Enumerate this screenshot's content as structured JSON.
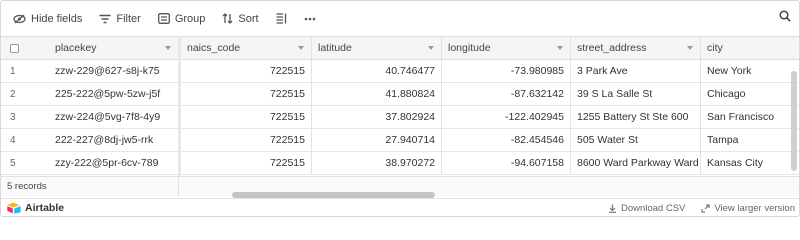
{
  "toolbar": {
    "hide_fields": "Hide fields",
    "filter": "Filter",
    "group": "Group",
    "sort": "Sort"
  },
  "table": {
    "columns": [
      "placekey",
      "naics_code",
      "latitude",
      "longitude",
      "street_address",
      "city"
    ],
    "rows": [
      {
        "num": "1",
        "placekey": "zzw-229@627-s8j-k75",
        "naics_code": "722515",
        "latitude": "40.746477",
        "longitude": "-73.980985",
        "street_address": "3 Park Ave",
        "city": "New York"
      },
      {
        "num": "2",
        "placekey": "225-222@5pw-5zw-j5f",
        "naics_code": "722515",
        "latitude": "41.880824",
        "longitude": "-87.632142",
        "street_address": "39 S La Salle St",
        "city": "Chicago"
      },
      {
        "num": "3",
        "placekey": "zzw-224@5vg-7f8-4y9",
        "naics_code": "722515",
        "latitude": "37.802924",
        "longitude": "-122.402945",
        "street_address": "1255 Battery St Ste 600",
        "city": "San Francisco"
      },
      {
        "num": "4",
        "placekey": "222-227@8dj-jw5-rrk",
        "naics_code": "722515",
        "latitude": "27.940714",
        "longitude": "-82.454546",
        "street_address": "505 Water St",
        "city": "Tampa"
      },
      {
        "num": "5",
        "placekey": "zzy-222@5pr-6cv-789",
        "naics_code": "722515",
        "latitude": "38.970272",
        "longitude": "-94.607158",
        "street_address": "8600 Ward Parkway Ward P...",
        "city": "Kansas City"
      }
    ]
  },
  "footer": {
    "records": "5 records",
    "brand": "Airtable",
    "download_csv": "Download CSV",
    "view_larger": "View larger version"
  },
  "icons": {
    "hide": "eye-slash-icon",
    "filter": "filter-icon",
    "group": "group-icon",
    "sort": "sort-icon",
    "row_height": "row-height-icon",
    "more": "more-icon",
    "search": "search-icon"
  }
}
